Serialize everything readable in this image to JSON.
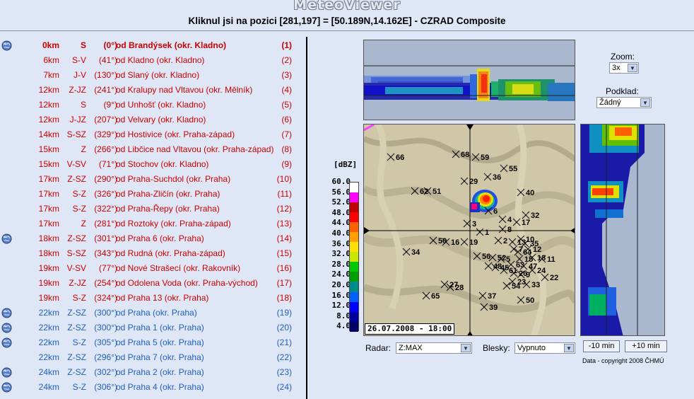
{
  "header": {
    "app_title": "MeteoViewer",
    "subtitle": "Kliknul jsi na pozici [281,197] = [50.189N,14.162E] - CZRAD Composite"
  },
  "locations": [
    {
      "dist": "0km",
      "dir": "S",
      "deg": "(0°)",
      "name": "od Brandýsek (okr. Kladno)",
      "idx": "(1)",
      "color": "red",
      "bold": true,
      "globe": true
    },
    {
      "dist": "6km",
      "dir": "S-V",
      "deg": "(41°)",
      "name": "od Kladno (okr. Kladno)",
      "idx": "(2)",
      "color": "red",
      "bold": false,
      "globe": false
    },
    {
      "dist": "7km",
      "dir": "J-V",
      "deg": "(130°)",
      "name": "od Slaný (okr. Kladno)",
      "idx": "(3)",
      "color": "red",
      "bold": false,
      "globe": false
    },
    {
      "dist": "12km",
      "dir": "Z-JZ",
      "deg": "(241°)",
      "name": "od Kralupy nad Vltavou (okr. Mělník)",
      "idx": "(4)",
      "color": "red",
      "bold": false,
      "globe": false
    },
    {
      "dist": "12km",
      "dir": "S",
      "deg": "(9°)",
      "name": "od Unhošť (okr. Kladno)",
      "idx": "(5)",
      "color": "red",
      "bold": false,
      "globe": false
    },
    {
      "dist": "12km",
      "dir": "J-JZ",
      "deg": "(207°)",
      "name": "od Velvary (okr. Kladno)",
      "idx": "(6)",
      "color": "red",
      "bold": false,
      "globe": false
    },
    {
      "dist": "14km",
      "dir": "S-SZ",
      "deg": "(329°)",
      "name": "od Hostivice (okr. Praha-západ)",
      "idx": "(7)",
      "color": "red",
      "bold": false,
      "globe": false
    },
    {
      "dist": "15km",
      "dir": "Z",
      "deg": "(266°)",
      "name": "od Libčice nad Vltavou (okr. Praha-západ)",
      "idx": "(8)",
      "color": "red",
      "bold": false,
      "globe": false
    },
    {
      "dist": "15km",
      "dir": "V-SV",
      "deg": "(71°)",
      "name": "od Stochov (okr. Kladno)",
      "idx": "(9)",
      "color": "red",
      "bold": false,
      "globe": false
    },
    {
      "dist": "17km",
      "dir": "Z-SZ",
      "deg": "(290°)",
      "name": "od Praha-Suchdol (okr. Praha)",
      "idx": "(10)",
      "color": "red",
      "bold": false,
      "globe": false
    },
    {
      "dist": "17km",
      "dir": "S-Z",
      "deg": "(326°)",
      "name": "od Praha-Zličín (okr. Praha)",
      "idx": "(11)",
      "color": "red",
      "bold": false,
      "globe": false
    },
    {
      "dist": "17km",
      "dir": "S-Z",
      "deg": "(322°)",
      "name": "od Praha-Řepy (okr. Praha)",
      "idx": "(12)",
      "color": "red",
      "bold": false,
      "globe": false
    },
    {
      "dist": "17km",
      "dir": "Z",
      "deg": "(281°)",
      "name": "od Roztoky (okr. Praha-západ)",
      "idx": "(13)",
      "color": "red",
      "bold": false,
      "globe": false
    },
    {
      "dist": "18km",
      "dir": "Z-SZ",
      "deg": "(301°)",
      "name": "od Praha 6 (okr. Praha)",
      "idx": "(14)",
      "color": "red",
      "bold": false,
      "globe": true
    },
    {
      "dist": "18km",
      "dir": "S-SZ",
      "deg": "(343°)",
      "name": "od Rudná (okr. Praha-západ)",
      "idx": "(15)",
      "color": "red",
      "bold": false,
      "globe": false
    },
    {
      "dist": "19km",
      "dir": "V-SV",
      "deg": "(77°)",
      "name": "od Nové Strašecí (okr. Rakovník)",
      "idx": "(16)",
      "color": "red",
      "bold": false,
      "globe": false
    },
    {
      "dist": "19km",
      "dir": "Z-JZ",
      "deg": "(254°)",
      "name": "od Odolena Voda (okr. Praha-východ)",
      "idx": "(17)",
      "color": "red",
      "bold": false,
      "globe": false
    },
    {
      "dist": "19km",
      "dir": "S-Z",
      "deg": "(324°)",
      "name": "od Praha 13 (okr. Praha)",
      "idx": "(18)",
      "color": "red",
      "bold": false,
      "globe": false
    },
    {
      "dist": "22km",
      "dir": "Z-SZ",
      "deg": "(300°)",
      "name": "od Praha (okr. Praha)",
      "idx": "(19)",
      "color": "blue",
      "bold": false,
      "globe": true
    },
    {
      "dist": "22km",
      "dir": "Z-SZ",
      "deg": "(300°)",
      "name": "od Praha 1 (okr. Praha)",
      "idx": "(20)",
      "color": "blue",
      "bold": false,
      "globe": true
    },
    {
      "dist": "22km",
      "dir": "S-Z",
      "deg": "(305°)",
      "name": "od Praha 5 (okr. Praha)",
      "idx": "(21)",
      "color": "blue",
      "bold": false,
      "globe": true
    },
    {
      "dist": "22km",
      "dir": "Z-SZ",
      "deg": "(296°)",
      "name": "od Praha 7 (okr. Praha)",
      "idx": "(22)",
      "color": "blue",
      "bold": false,
      "globe": false
    },
    {
      "dist": "24km",
      "dir": "Z-SZ",
      "deg": "(302°)",
      "name": "od Praha 2 (okr. Praha)",
      "idx": "(23)",
      "color": "blue",
      "bold": false,
      "globe": true
    },
    {
      "dist": "24km",
      "dir": "S-Z",
      "deg": "(306°)",
      "name": "od Praha 4 (okr. Praha)",
      "idx": "(24)",
      "color": "blue",
      "bold": false,
      "globe": true
    }
  ],
  "legend": {
    "unit": "[dBZ]",
    "values": [
      "60.0",
      "56.0",
      "52.0",
      "48.0",
      "44.0",
      "40.0",
      "36.0",
      "32.0",
      "28.0",
      "24.0",
      "20.0",
      "16.0",
      "12.0",
      "8.0",
      "4.0"
    ],
    "colors": [
      "#ffffff",
      "#ff00ff",
      "#c00000",
      "#ff0000",
      "#ff6000",
      "#ffa000",
      "#ffe000",
      "#c8e800",
      "#00c800",
      "#00a000",
      "#008c8c",
      "#0060ff",
      "#0000ff",
      "#0000a0",
      "#000066"
    ]
  },
  "map": {
    "timestamp": "26.07.2008 - 18:00",
    "markers": [
      "66",
      "68",
      "59",
      "55",
      "36",
      "29",
      "62",
      "51",
      "40",
      "6",
      "32",
      "3",
      "4",
      "17",
      "8",
      "1",
      "50",
      "16",
      "19",
      "2",
      "13",
      "10",
      "35",
      "34",
      "56",
      "52",
      "5",
      "7",
      "12",
      "11",
      "48",
      "45",
      "63",
      "15",
      "18",
      "47",
      "26",
      "27",
      "22",
      "28",
      "65",
      "37",
      "54",
      "50",
      "39",
      "64",
      "61",
      "9",
      "33",
      "24",
      "23"
    ]
  },
  "controls": {
    "zoom_label": "Zoom:",
    "zoom_value": "3x",
    "podklad_label": "Podklad:",
    "podklad_value": "Žádný",
    "radar_label": "Radar:",
    "radar_value": "Z:MAX",
    "blesky_label": "Blesky:",
    "blesky_value": "Vypnuto",
    "prev_button": "-10 min",
    "next_button": "+10 min",
    "copyright": "Data - copyright 2008 ČHMÚ"
  }
}
